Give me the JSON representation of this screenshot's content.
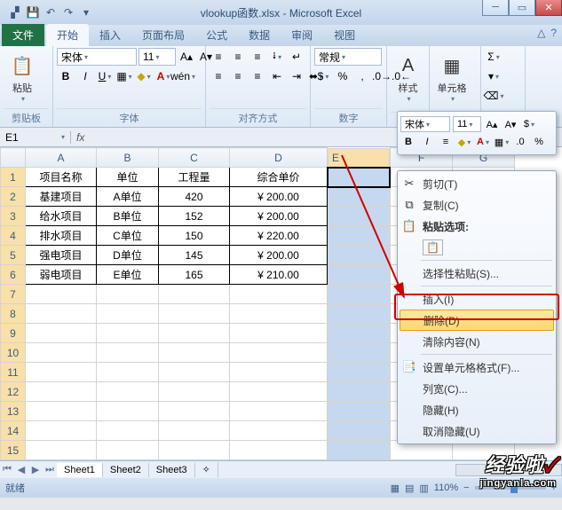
{
  "title": "vlookup函数.xlsx - Microsoft Excel",
  "tabs": {
    "file": "文件",
    "home": "开始",
    "insert": "插入",
    "layout": "页面布局",
    "formulas": "公式",
    "data": "数据",
    "review": "审阅",
    "view": "视图"
  },
  "ribbon": {
    "paste": "粘贴",
    "clipboard": "剪贴板",
    "font_name": "宋体",
    "font_size": "11",
    "font_group": "字体",
    "align_group": "对齐方式",
    "number_format": "常规",
    "number_group": "数字",
    "styles": "样式",
    "cells": "单元格"
  },
  "namebox": "E1",
  "fx": "fx",
  "columns": [
    "A",
    "B",
    "C",
    "D",
    "E",
    "F",
    "G"
  ],
  "sel_col": "E",
  "rows": [
    "1",
    "2",
    "3",
    "4",
    "5",
    "6",
    "7",
    "8",
    "9",
    "10",
    "11",
    "12",
    "13",
    "14",
    "15"
  ],
  "table": {
    "headers": [
      "项目名称",
      "单位",
      "工程量",
      "综合单价"
    ],
    "rows": [
      {
        "name": "基建项目",
        "unit": "A单位",
        "qty": "420",
        "price": "¥   200.00"
      },
      {
        "name": "给水项目",
        "unit": "B单位",
        "qty": "152",
        "price": "¥   200.00"
      },
      {
        "name": "排水项目",
        "unit": "C单位",
        "qty": "150",
        "price": "¥   220.00"
      },
      {
        "name": "强电项目",
        "unit": "D单位",
        "qty": "145",
        "price": "¥   200.00"
      },
      {
        "name": "弱电项目",
        "unit": "E单位",
        "qty": "165",
        "price": "¥   210.00"
      }
    ]
  },
  "mini": {
    "font": "宋体",
    "size": "11"
  },
  "cmenu": {
    "cut": "剪切(T)",
    "copy": "复制(C)",
    "paste_opts": "粘贴选项:",
    "paste_special": "选择性粘贴(S)...",
    "insert": "插入(I)",
    "delete": "删除(D)",
    "clear": "清除内容(N)",
    "format": "设置单元格格式(F)...",
    "colwidth": "列宽(C)...",
    "hide": "隐藏(H)",
    "unhide": "取消隐藏(U)"
  },
  "sheets": {
    "s1": "Sheet1",
    "s2": "Sheet2",
    "s3": "Sheet3"
  },
  "status": {
    "ready": "就绪",
    "zoom": "110%"
  },
  "watermark": {
    "big": "经验啦",
    "small": "jingyanla.com"
  }
}
